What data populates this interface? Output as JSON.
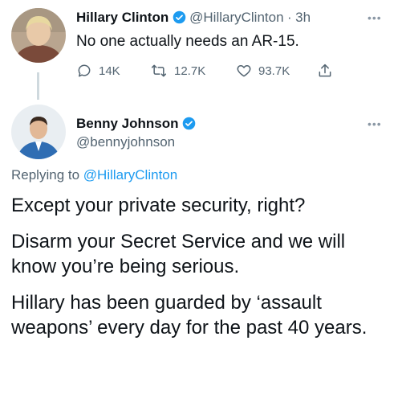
{
  "tweet1": {
    "name": "Hillary Clinton",
    "handle": "@HillaryClinton",
    "separator": "·",
    "time": "3h",
    "text": "No one actually needs an AR-15.",
    "stats": {
      "replies": "14K",
      "retweets": "12.7K",
      "likes": "93.7K"
    }
  },
  "tweet2": {
    "name": "Benny Johnson",
    "handle": "@bennyjohnson",
    "replying_prefix": "Replying to",
    "replying_handle": "@HillaryClinton",
    "paragraphs": [
      "Except your private security, right?",
      "Disarm your Secret Service and we will know you’re being serious.",
      "Hillary has been guarded by ‘assault weapons’ every day for the past 40 years."
    ]
  },
  "colors": {
    "verified": "#1d9bf0",
    "secondary_text": "#536471",
    "link": "#1d9bf0"
  }
}
